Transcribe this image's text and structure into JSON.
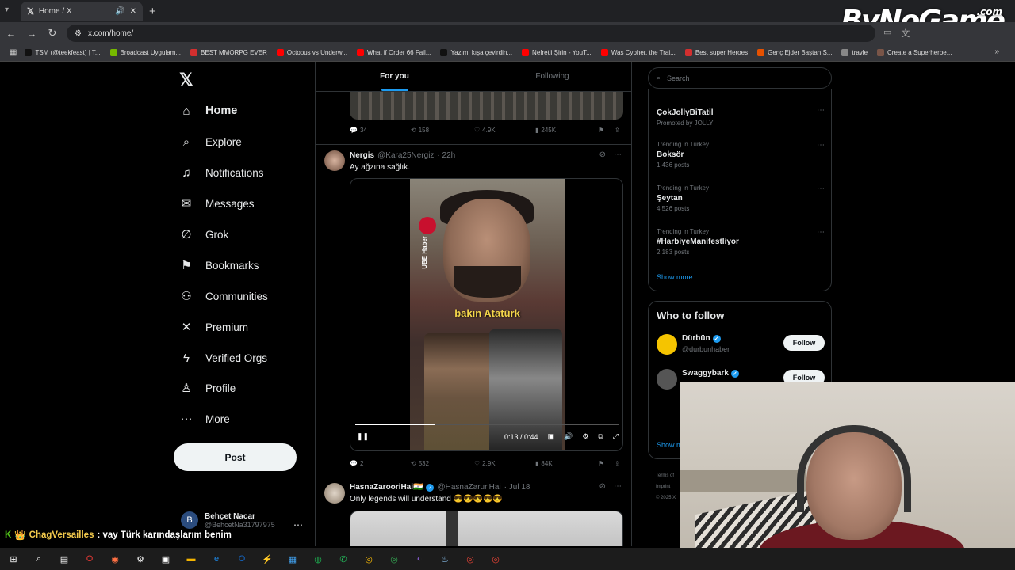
{
  "browser": {
    "tab_title": "Home / X",
    "url": "x.com/home/",
    "bookmarks": [
      {
        "label": "TSM (@teekfeast) | T...",
        "color": "#111111"
      },
      {
        "label": "Broadcast Uygulam...",
        "color": "#76b900"
      },
      {
        "label": "BEST MMORPG EVER",
        "color": "#d32f2f"
      },
      {
        "label": "Octopus vs Underw...",
        "color": "#ff0000"
      },
      {
        "label": "What if Order 66 Fail...",
        "color": "#ff0000"
      },
      {
        "label": "Yazımı kışa çevirdin...",
        "color": "#111111"
      },
      {
        "label": "Nefretli Şirin - YouT...",
        "color": "#ff0000"
      },
      {
        "label": "Was Cypher, the Trai...",
        "color": "#ff0000"
      },
      {
        "label": "Best super Heroes",
        "color": "#d32f2f"
      },
      {
        "label": "Genç Ejder Baştan S...",
        "color": "#e65100"
      },
      {
        "label": "travle",
        "color": "#888888"
      },
      {
        "label": "Create a Superheroe...",
        "color": "#795548"
      }
    ]
  },
  "brand_overlay": {
    "text": "ByNoGame",
    "suffix": ".com"
  },
  "nav": {
    "items": [
      {
        "label": "Home",
        "icon": "⌂"
      },
      {
        "label": "Explore",
        "icon": "⌕"
      },
      {
        "label": "Notifications",
        "icon": "♫"
      },
      {
        "label": "Messages",
        "icon": "✉"
      },
      {
        "label": "Grok",
        "icon": "∅"
      },
      {
        "label": "Bookmarks",
        "icon": "⚑"
      },
      {
        "label": "Communities",
        "icon": "⚇"
      },
      {
        "label": "Premium",
        "icon": "✕"
      },
      {
        "label": "Verified Orgs",
        "icon": "ϟ"
      },
      {
        "label": "Profile",
        "icon": "♙"
      },
      {
        "label": "More",
        "icon": "⋯"
      }
    ],
    "post_label": "Post",
    "account": {
      "initial": "B",
      "name": "Behçet Nacar",
      "handle": "@BehcetNa31797975"
    }
  },
  "feed": {
    "tabs": [
      "For you",
      "Following"
    ],
    "tweet0_actions": {
      "replies": "34",
      "reposts": "158",
      "likes": "4.9K",
      "views": "245K"
    },
    "tweet1": {
      "name": "Nergis",
      "handle": "@Kara25Nergiz",
      "time": "· 22h",
      "text": "Ay ağzına sağlık.",
      "video_caption": "bakın Atatürk",
      "video_side_label": "UBE Haber",
      "video_time": "0:13 / 0:44",
      "video_progress": 0.3,
      "actions": {
        "replies": "2",
        "reposts": "532",
        "likes": "2.9K",
        "views": "84K"
      }
    },
    "tweet2": {
      "name": "HasnaZarooriHai🇮🇳",
      "handle": "@HasnaZaruriHai",
      "time": "· Jul 18",
      "text": "Only legends will understand 😎😎😎😎😎"
    }
  },
  "sidebar": {
    "search_placeholder": "Search",
    "promoted": {
      "title": "ÇokJollyBiTatil",
      "sub": "Promoted by JOLLY"
    },
    "trends": [
      {
        "context": "Trending in Turkey",
        "title": "Boksör",
        "count": "1,436 posts"
      },
      {
        "context": "Trending in Turkey",
        "title": "Şeytan",
        "count": "4,526 posts"
      },
      {
        "context": "Trending in Turkey",
        "title": "#HarbiyeManifestliyor",
        "count": "2,183 posts"
      }
    ],
    "show_more": "Show more",
    "who_to_follow": {
      "title": "Who to follow",
      "accounts": [
        {
          "name": "Dürbün",
          "handle": "@durbunhaber",
          "follow": "Follow",
          "color": "#f5c400"
        },
        {
          "name": "Swaggybark",
          "handle": "",
          "follow": "Follow",
          "color": "#555555"
        }
      ],
      "show_more_partial": "Show m"
    },
    "footer": [
      "Terms of",
      "Imprint",
      "© 2025 X"
    ]
  },
  "chat_overlay": {
    "user": "ChagVersailles",
    "message": ": vay Türk karındaşlarım benim"
  },
  "colors": {
    "accent": "#1d9bf0",
    "background": "#000000",
    "border": "#2f3336",
    "muted": "#71767b"
  }
}
